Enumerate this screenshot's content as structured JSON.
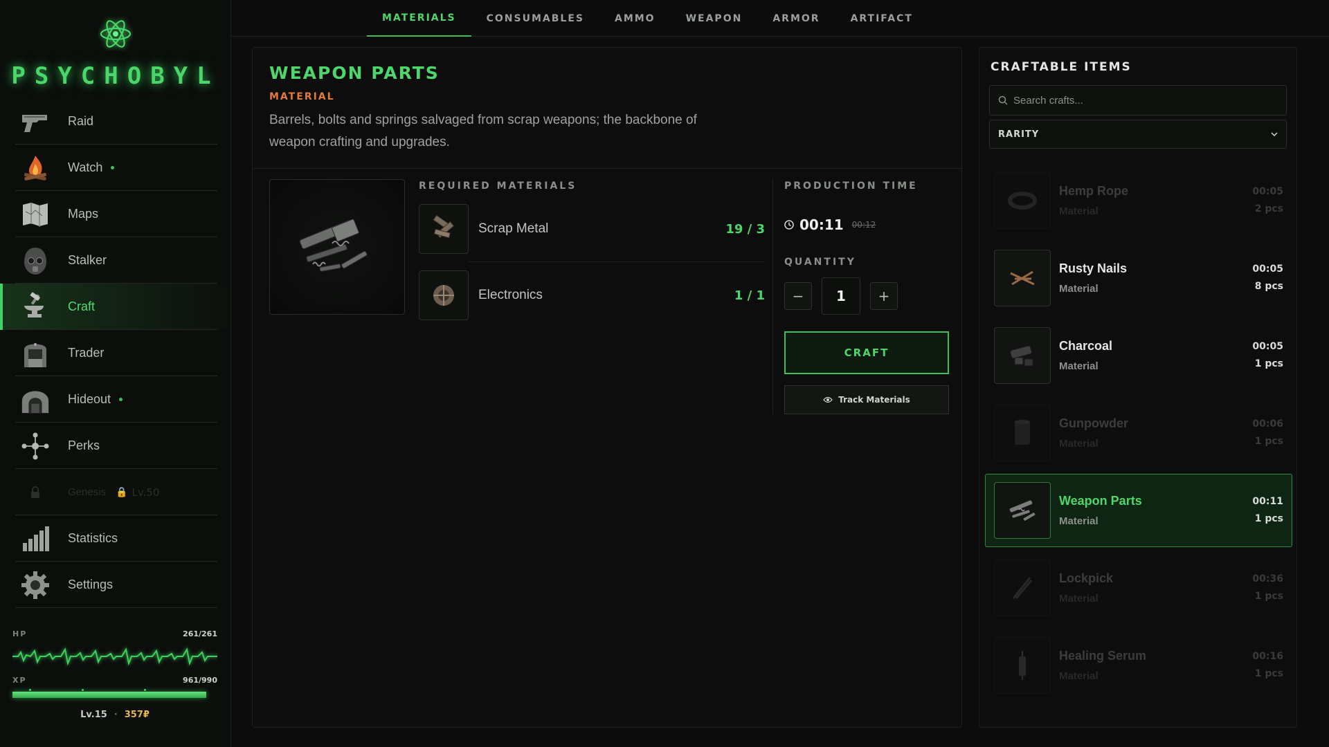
{
  "app": {
    "name": "PSYCHOBYL"
  },
  "colors": {
    "accent": "#4fd66b",
    "material_tag": "#e27a3a",
    "money": "#e6b84a"
  },
  "sidebar": {
    "items": [
      {
        "label": "Raid",
        "icon": "pistol-icon",
        "dot": false,
        "active": false
      },
      {
        "label": "Watch",
        "icon": "campfire-icon",
        "dot": true,
        "active": false
      },
      {
        "label": "Maps",
        "icon": "map-icon",
        "dot": false,
        "active": false
      },
      {
        "label": "Stalker",
        "icon": "gasmask-icon",
        "dot": false,
        "active": false
      },
      {
        "label": "Craft",
        "icon": "anvil-icon",
        "dot": false,
        "active": true
      },
      {
        "label": "Trader",
        "icon": "trader-booth-icon",
        "dot": false,
        "active": false
      },
      {
        "label": "Hideout",
        "icon": "bunker-icon",
        "dot": true,
        "active": false
      },
      {
        "label": "Perks",
        "icon": "perk-tree-icon",
        "dot": false,
        "active": false
      }
    ],
    "locked_item": {
      "label": "Genesis",
      "level": "Lv.50",
      "icon": "lock-icon"
    },
    "bottom_items": [
      {
        "label": "Statistics",
        "icon": "bar-chart-icon"
      },
      {
        "label": "Settings",
        "icon": "gear-icon"
      }
    ],
    "stats": {
      "hp_label": "HP",
      "hp_value": "261/261",
      "xp_label": "XP",
      "xp_value": "961/990",
      "xp_fraction": 0.971,
      "level": "Lv.15",
      "money": "357₽"
    }
  },
  "tabs": [
    {
      "label": "MATERIALS",
      "active": true
    },
    {
      "label": "CONSUMABLES",
      "active": false
    },
    {
      "label": "AMMO",
      "active": false
    },
    {
      "label": "WEAPON",
      "active": false
    },
    {
      "label": "ARMOR",
      "active": false
    },
    {
      "label": "ARTIFACT",
      "active": false
    }
  ],
  "detail": {
    "title": "WEAPON PARTS",
    "type": "MATERIAL",
    "description": "Barrels, bolts and springs salvaged from scrap weapons; the backbone of weapon crafting and upgrades.",
    "required_label": "REQUIRED MATERIALS",
    "materials": [
      {
        "name": "Scrap Metal",
        "count": "19 / 3",
        "icon": "scrap-metal-icon"
      },
      {
        "name": "Electronics",
        "count": "1 / 1",
        "icon": "electronics-icon"
      }
    ],
    "production_label": "PRODUCTION TIME",
    "time": "00:11",
    "time_old": "00:12",
    "quantity_label": "QUANTITY",
    "quantity": "1",
    "minus": "−",
    "plus": "+",
    "craft_label": "CRAFT",
    "track_label": "Track Materials"
  },
  "craftable": {
    "title": "CRAFTABLE ITEMS",
    "search_placeholder": "Search crafts...",
    "rarity_label": "RARITY",
    "items": [
      {
        "name": "Hemp Rope",
        "type": "Material",
        "time": "00:05",
        "qty": "2 pcs",
        "state": "dim",
        "icon": "rope-icon"
      },
      {
        "name": "Rusty Nails",
        "type": "Material",
        "time": "00:05",
        "qty": "8 pcs",
        "state": "normal",
        "icon": "nails-icon"
      },
      {
        "name": "Charcoal",
        "type": "Material",
        "time": "00:05",
        "qty": "1 pcs",
        "state": "normal",
        "icon": "charcoal-icon"
      },
      {
        "name": "Gunpowder",
        "type": "Material",
        "time": "00:06",
        "qty": "1 pcs",
        "state": "dim",
        "icon": "gunpowder-can-icon"
      },
      {
        "name": "Weapon Parts",
        "type": "Material",
        "time": "00:11",
        "qty": "1 pcs",
        "state": "active",
        "icon": "weapon-parts-icon"
      },
      {
        "name": "Lockpick",
        "type": "Material",
        "time": "00:36",
        "qty": "1 pcs",
        "state": "dim",
        "icon": "lockpick-icon"
      },
      {
        "name": "Healing Serum",
        "type": "Material",
        "time": "00:16",
        "qty": "1 pcs",
        "state": "dim",
        "icon": "syringe-icon"
      }
    ]
  }
}
